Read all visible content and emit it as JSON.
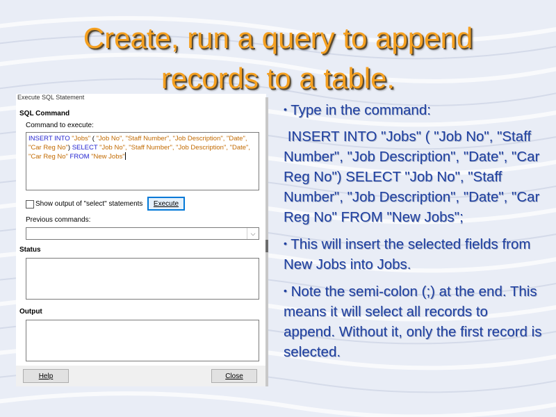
{
  "slide": {
    "title_line1": "Create, run a query to append",
    "title_line2": "records to a table.",
    "colors": {
      "title": "#f5a020",
      "text": "#1e3fa0",
      "background": "#e9edf6"
    }
  },
  "dialog": {
    "window_title": "Execute SQL Statement",
    "sql_command_label": "SQL Command",
    "command_to_execute_label": "Command to execute:",
    "sql": {
      "insert_kw": "INSERT INTO",
      "jobs": "\"Jobs\"",
      "open_paren": " ( ",
      "insert_fields": "\"Job No\", \"Staff Number\", \"Job Description\", \"Date\", \"Car Reg No\"",
      "close_paren": ") ",
      "select_kw": "SELECT",
      "select_fields": " \"Job No\", \"Staff Number\", \"Job Description\", \"Date\", \"Car Reg No\"",
      "from_kw": " FROM ",
      "new_jobs": "\"New Jobs\""
    },
    "show_output_label": "Show output of \"select\" statements",
    "execute_button": "Execute",
    "previous_commands_label": "Previous commands:",
    "status_label": "Status",
    "output_label": "Output",
    "help_button": "Help",
    "close_button": "Close"
  },
  "bullets": {
    "b1": "Type in the command:",
    "b1_command": "INSERT INTO \"Jobs\" ( \"Job No\", \"Staff Number\", \"Job Description\", \"Date\", \"Car Reg No\") SELECT  \"Job No\", \"Staff Number\", \"Job Description\", \"Date\", \"Car Reg No\" FROM \"New Jobs\";",
    "b2": "This will insert the selected fields from New Jobs into Jobs.",
    "b3": "Note the semi-colon (;) at the end. This means it will select all records to append. Without it, only the first record is selected."
  }
}
